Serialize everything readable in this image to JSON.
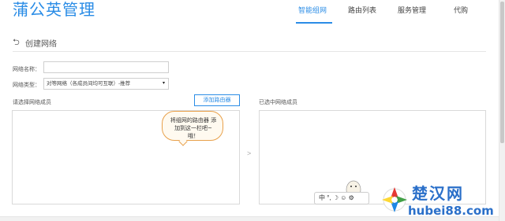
{
  "header": {
    "brand": "蒲公英管理",
    "nav": [
      "智能组网",
      "路由列表",
      "服务管理",
      "代购"
    ],
    "accent": "#2a8ce6"
  },
  "page": {
    "back_icon": "back-arrow-icon",
    "title": "创建网络"
  },
  "form": {
    "name_label": "网络名称：",
    "name_value": "",
    "type_label": "网络类型：",
    "type_value": "对等网络（各成员间均可互联）-推荐",
    "select_arrow": "▾"
  },
  "members": {
    "select_label": "请选择网络成员",
    "add_button": "添加路由器",
    "selected_label": "已选中网络成员",
    "transfer_arrow": ">"
  },
  "bubble": {
    "text": "将组网的路由器 添加到这一栏吧~ 哦！"
  },
  "ime": {
    "text": "中 °, ☽ ☺ ⚙"
  },
  "watermark": {
    "site": "楚汉网",
    "url": "hubei88.com"
  }
}
